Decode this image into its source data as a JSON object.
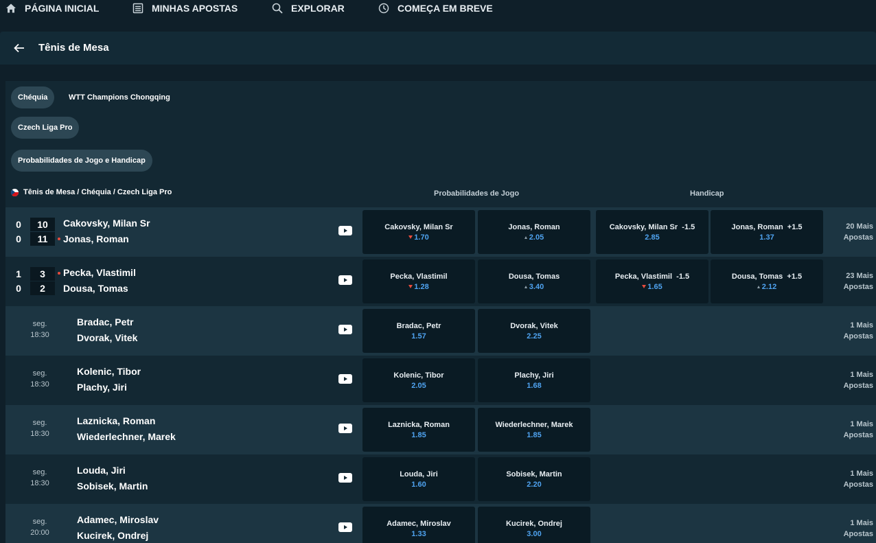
{
  "nav": {
    "home": "PÁGINA INICIAL",
    "bets": "MINHAS APOSTAS",
    "explore": "EXPLORAR",
    "soon": "COMEÇA EM BREVE"
  },
  "sport": {
    "title": "Tênis de Mesa"
  },
  "chips": {
    "country": "Chéquia",
    "tournament": "WTT Champions Chongqing",
    "league": "Czech Liga Pro",
    "market": "Probabilidades de Jogo e Handicap"
  },
  "league_path": "Tênis de Mesa / Chéquia / Czech Liga Pro",
  "columns": {
    "match_odds": "Probabilidades de Jogo",
    "handicap": "Handicap"
  },
  "live": [
    {
      "sets": [
        "0",
        "0"
      ],
      "games": [
        "10",
        "11"
      ],
      "p1": "Cakovsky, Milan Sr",
      "p2": "Jonas, Roman",
      "odds": [
        {
          "name": "Cakovsky, Milan Sr",
          "value": "1.70"
        },
        {
          "name": "Jonas, Roman",
          "value": "2.05"
        }
      ],
      "handicap": [
        {
          "name": "Cakovsky, Milan Sr",
          "line": "-1.5",
          "value": "2.85"
        },
        {
          "name": "Jonas, Roman",
          "line": "+1.5",
          "value": "1.37"
        }
      ],
      "more": "20 Mais",
      "more2": "Apostas"
    },
    {
      "sets": [
        "1",
        "0"
      ],
      "games": [
        "3",
        "2"
      ],
      "p1": "Pecka, Vlastimil",
      "p2": "Dousa, Tomas",
      "odds": [
        {
          "name": "Pecka, Vlastimil",
          "value": "1.28"
        },
        {
          "name": "Dousa, Tomas",
          "value": "3.40"
        }
      ],
      "handicap": [
        {
          "name": "Pecka, Vlastimil",
          "line": "-1.5",
          "value": "1.65"
        },
        {
          "name": "Dousa, Tomas",
          "line": "+1.5",
          "value": "2.12"
        }
      ],
      "more": "23 Mais",
      "more2": "Apostas"
    }
  ],
  "upcoming": [
    {
      "day": "seg.",
      "time": "18:30",
      "p1": "Bradac, Petr",
      "p2": "Dvorak, Vitek",
      "o1": "1.57",
      "o2": "2.25",
      "more": "1 Mais",
      "more2": "Apostas"
    },
    {
      "day": "seg.",
      "time": "18:30",
      "p1": "Kolenic, Tibor",
      "p2": "Plachy, Jiri",
      "o1": "2.05",
      "o2": "1.68",
      "more": "1 Mais",
      "more2": "Apostas"
    },
    {
      "day": "seg.",
      "time": "18:30",
      "p1": "Laznicka, Roman",
      "p2": "Wiederlechner, Marek",
      "o1": "1.85",
      "o2": "1.85",
      "more": "1 Mais",
      "more2": "Apostas"
    },
    {
      "day": "seg.",
      "time": "18:30",
      "p1": "Louda, Jiri",
      "p2": "Sobisek, Martin",
      "o1": "1.60",
      "o2": "2.20",
      "more": "1 Mais",
      "more2": "Apostas"
    },
    {
      "day": "seg.",
      "time": "20:00",
      "p1": "Adamec, Miroslav",
      "p2": "Kucirek, Ondrej",
      "o1": "1.33",
      "o2": "3.00",
      "more": "1 Mais",
      "more2": "Apostas"
    }
  ]
}
